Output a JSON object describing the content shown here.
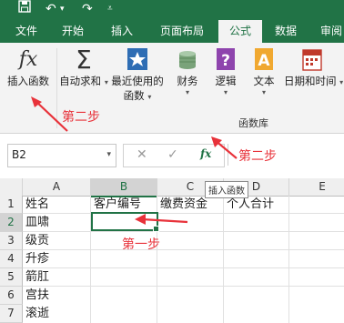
{
  "titlebar": {
    "icons": [
      "save-icon",
      "undo-icon",
      "redo-icon",
      "customize-icon"
    ],
    "undo_glyph": "↶",
    "redo_glyph": "↷"
  },
  "tabs": [
    {
      "label": "文件",
      "active": false
    },
    {
      "label": "开始",
      "active": false
    },
    {
      "label": "插入",
      "active": false
    },
    {
      "label": "页面布局",
      "active": false
    },
    {
      "label": "公式",
      "active": true
    },
    {
      "label": "数据",
      "active": false
    },
    {
      "label": "审阅",
      "active": false
    }
  ],
  "ribbon": {
    "insert_function": {
      "icon_text": "fx",
      "label": "插入函数"
    },
    "autosum": {
      "label": "自动求和"
    },
    "recent": {
      "label_line1": "最近使用的",
      "label_line2": "函数"
    },
    "financial": {
      "label": "财务"
    },
    "logical": {
      "label": "逻辑"
    },
    "text": {
      "label": "文本",
      "icon_text": "A"
    },
    "datetime": {
      "label": "日期和时间"
    },
    "group_label": "函数库"
  },
  "formula_bar": {
    "name_box": "B2",
    "cancel_glyph": "✕",
    "enter_glyph": "✓",
    "fx_label": "fx",
    "value": ""
  },
  "tooltip": "插入函数",
  "sheet": {
    "columns": [
      "A",
      "B",
      "C",
      "D",
      "E"
    ],
    "rows": [
      "1",
      "2",
      "3",
      "4",
      "5",
      "6",
      "7"
    ],
    "selected_cell": "B2",
    "cells": {
      "A1": "姓名",
      "B1": "客户编号",
      "C1": "缴费资金",
      "D1": "个人合计",
      "A2": "皿啸",
      "A3": "级贡",
      "A4": "升疹",
      "A5": "箭肛",
      "A6": "宫扶",
      "A7": "滚逝"
    }
  },
  "annotations": {
    "step1": "第一步",
    "step2a": "第二步",
    "step2b": "第二步"
  },
  "colors": {
    "accent": "#217346",
    "annotation": "#e8323a"
  }
}
